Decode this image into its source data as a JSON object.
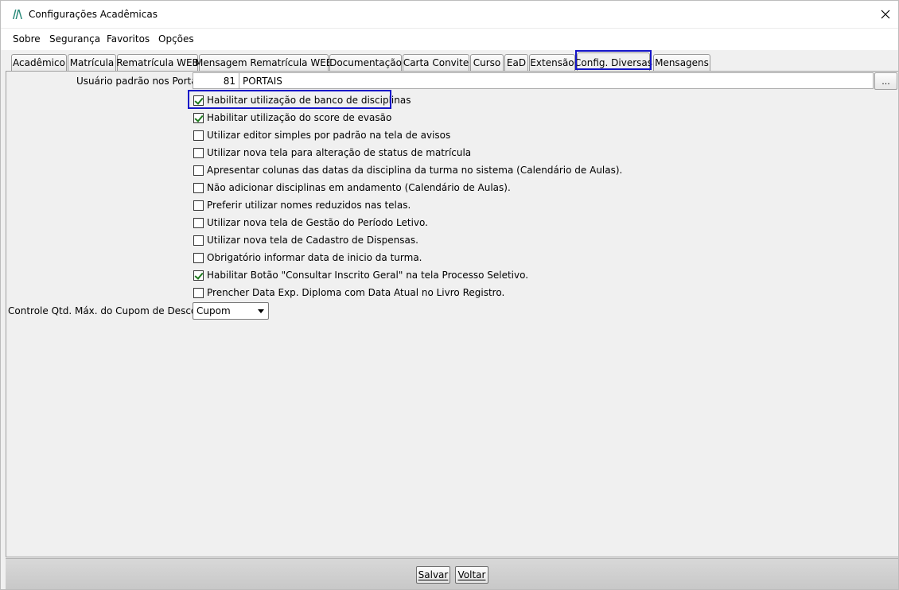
{
  "window": {
    "title": "Configurações Acadêmicas"
  },
  "menu": [
    {
      "label": "Sobre"
    },
    {
      "label": "Segurança"
    },
    {
      "label": "Favoritos"
    },
    {
      "label": "Opções"
    }
  ],
  "tabs": [
    {
      "label": "Acadêmico"
    },
    {
      "label": "Matrícula"
    },
    {
      "label": "Rematrícula WEB"
    },
    {
      "label": "Mensagem Rematrícula WEB"
    },
    {
      "label": "Documentação"
    },
    {
      "label": "Carta Convite"
    },
    {
      "label": "Curso"
    },
    {
      "label": "EaD"
    },
    {
      "label": "Extensão"
    },
    {
      "label": "Config. Diversas",
      "active": true
    },
    {
      "label": "Mensagens"
    }
  ],
  "portal_user": {
    "label": "Usuário padrão nos Portais:",
    "code": "81",
    "name": "PORTAIS",
    "lookup_label": "..."
  },
  "options": [
    {
      "label": "Habilitar utilização de banco de disciplinas",
      "checked": true
    },
    {
      "label": "Habilitar utilização do score de evasão",
      "checked": true
    },
    {
      "label": "Utilizar editor simples por padrão na tela de avisos",
      "checked": false
    },
    {
      "label": "Utilizar nova tela para alteração de status de matrícula",
      "checked": false
    },
    {
      "label": "Apresentar colunas das datas da disciplina da turma no sistema (Calendário de Aulas).",
      "checked": false
    },
    {
      "label": "Não adicionar disciplinas em andamento (Calendário de Aulas).",
      "checked": false
    },
    {
      "label": "Preferir utilizar nomes reduzidos nas telas.",
      "checked": false
    },
    {
      "label": "Utilizar nova tela de Gestão do Período Letivo.",
      "checked": false
    },
    {
      "label": "Utilizar nova tela de Cadastro de Dispensas.",
      "checked": false
    },
    {
      "label": "Obrigatório informar data de inicio da turma.",
      "checked": false
    },
    {
      "label": "Habilitar Botão \"Consultar Inscrito Geral\" na tela Processo Seletivo.",
      "checked": true
    },
    {
      "label": "Prencher Data Exp. Diploma com Data Atual no Livro Registro.",
      "checked": false
    }
  ],
  "coupon": {
    "label": "Controle Qtd. Máx. do Cupom de Desconto",
    "selected": "Cupom"
  },
  "buttons": {
    "save": "Salvar",
    "back": "Voltar"
  },
  "colors": {
    "highlight": "#1515c8",
    "check": "#1d7a1d",
    "logo": "#2a8a7a"
  }
}
